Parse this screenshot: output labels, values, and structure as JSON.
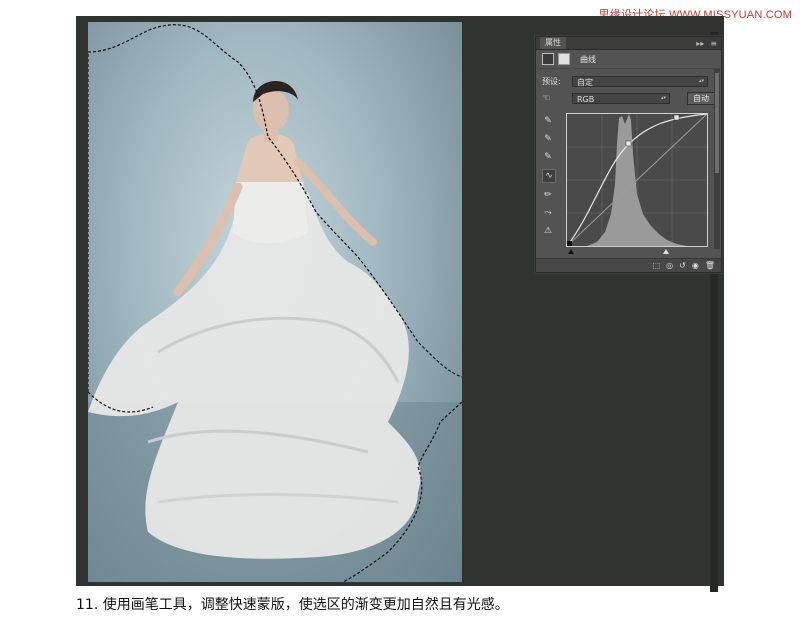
{
  "watermark": "思缘设计论坛 WWW.MISSYUAN.COM",
  "panel": {
    "tab": "属性",
    "title": "曲线",
    "preset_label": "预设:",
    "preset_value": "自定",
    "channel_value": "RGB",
    "auto_label": "自动"
  },
  "caption": "11. 使用画笔工具，调整快速蒙版，使选区的渐变更加自然且有光感。"
}
